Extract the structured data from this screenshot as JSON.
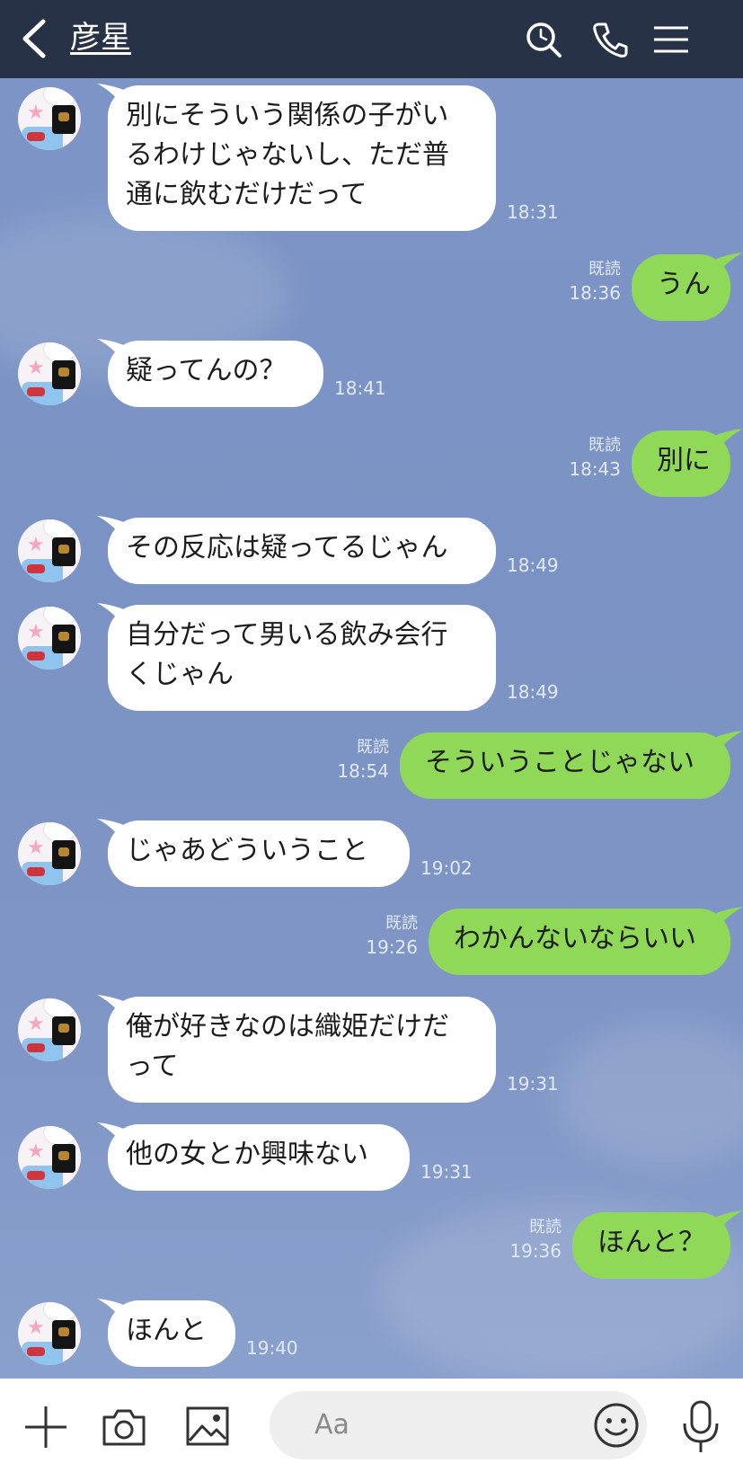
{
  "header": {
    "title": "彦星",
    "icons": [
      "back-chevron-icon",
      "search-icon",
      "phone-icon",
      "menu-icon"
    ]
  },
  "messages": [
    {
      "side": "in",
      "text": "別にそういう関係の子がい\nるわけじゃないし、ただ普\n通に飲むだけだって",
      "time": "18:31"
    },
    {
      "side": "out",
      "text": "うん",
      "read": "既読",
      "time": "18:36"
    },
    {
      "side": "in",
      "text": "疑ってんの？",
      "time": "18:41"
    },
    {
      "side": "out",
      "text": "別に",
      "read": "既読",
      "time": "18:43"
    },
    {
      "side": "in",
      "text": "その反応は疑ってるじゃん",
      "time": "18:49"
    },
    {
      "side": "in",
      "text": "自分だって男いる飲み会行\nくじゃん",
      "time": "18:49"
    },
    {
      "side": "out",
      "text": "そういうことじゃない",
      "read": "既読",
      "time": "18:54"
    },
    {
      "side": "in",
      "text": "じゃあどういうこと",
      "time": "19:02"
    },
    {
      "side": "out",
      "text": "わかんないならいい",
      "read": "既読",
      "time": "19:26"
    },
    {
      "side": "in",
      "text": "俺が好きなのは織姫だけだ\nって",
      "time": "19:31"
    },
    {
      "side": "in",
      "text": "他の女とか興味ない",
      "time": "19:31"
    },
    {
      "side": "out",
      "text": "ほんと？",
      "read": "既読",
      "time": "19:36"
    },
    {
      "side": "in",
      "text": "ほんと",
      "time": "19:40"
    }
  ],
  "input": {
    "placeholder": "Aa"
  },
  "colors": {
    "header_bg": "#273247",
    "outgoing_bubble": "#8fd858",
    "incoming_bubble": "#ffffff",
    "chat_bg": "#7c95c6"
  }
}
